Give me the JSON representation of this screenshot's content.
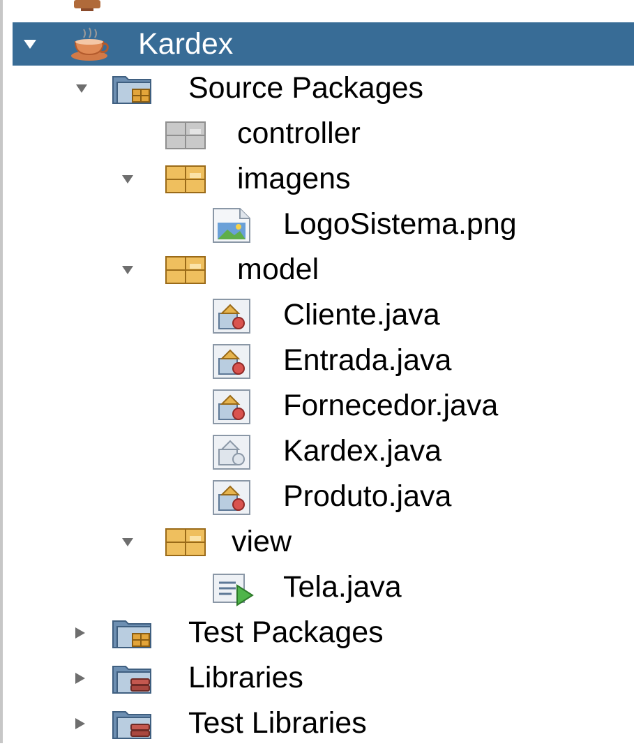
{
  "tree": {
    "project": {
      "label": "Kardex",
      "expanded": true,
      "selected": true,
      "icon": "coffee-cup-project-icon"
    },
    "source_packages": {
      "label": "Source Packages",
      "expanded": true,
      "icon": "source-packages-folder-icon"
    },
    "packages": {
      "controller": {
        "label": "controller",
        "icon": "empty-package-icon"
      },
      "imagens": {
        "label": "imagens",
        "expanded": true,
        "icon": "package-icon"
      },
      "model": {
        "label": "model",
        "expanded": true,
        "icon": "package-icon"
      },
      "view": {
        "label": "view",
        "expanded": true,
        "icon": "package-icon"
      }
    },
    "files": {
      "logo": {
        "label": "LogoSistema.png",
        "icon": "image-file-icon"
      },
      "cliente": {
        "label": "Cliente.java",
        "icon": "java-class-icon"
      },
      "entrada": {
        "label": "Entrada.java",
        "icon": "java-class-icon"
      },
      "fornecedor": {
        "label": "Fornecedor.java",
        "icon": "java-class-icon"
      },
      "kardex": {
        "label": "Kardex.java",
        "icon": "java-class-icon"
      },
      "produto": {
        "label": "Produto.java",
        "icon": "java-class-icon"
      },
      "tela": {
        "label": "Tela.java",
        "icon": "java-main-class-icon"
      }
    },
    "test_packages": {
      "label": "Test Packages",
      "expanded": false,
      "icon": "test-packages-folder-icon"
    },
    "libraries": {
      "label": "Libraries",
      "expanded": false,
      "icon": "libraries-folder-icon"
    },
    "test_libraries": {
      "label": "Test Libraries",
      "expanded": false,
      "icon": "test-libraries-folder-icon"
    }
  },
  "colors": {
    "selection": "#386c96",
    "package": "#e8b04a",
    "folder": "#7a98b8"
  }
}
